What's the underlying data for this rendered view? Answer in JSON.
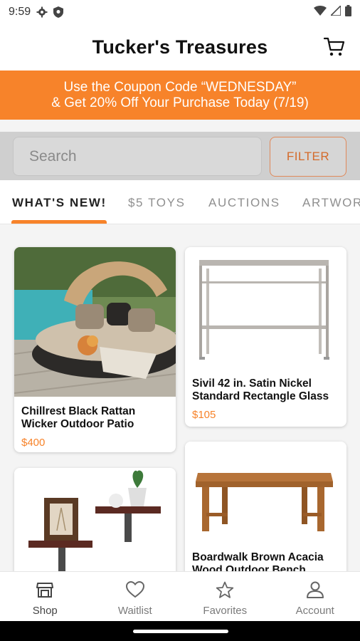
{
  "status_bar": {
    "time": "9:59"
  },
  "app": {
    "title": "Tucker's Treasures"
  },
  "promo": {
    "line1": "Use the Coupon Code “WEDNESDAY”",
    "line2": "& Get 20% Off Your Purchase Today (7/19)"
  },
  "search": {
    "placeholder": "Search",
    "filter_label": "FILTER"
  },
  "tabs": [
    {
      "label": "WHAT'S NEW!"
    },
    {
      "label": "$5 TOYS"
    },
    {
      "label": "AUCTIONS"
    },
    {
      "label": "ARTWOR"
    }
  ],
  "products": [
    {
      "name_line1": "Chillrest Black Rattan",
      "name_line2": "Wicker Outdoor Patio",
      "price": "$400"
    },
    {
      "name_line1": "Sivil 42 in. Satin Nickel",
      "name_line2": "Standard Rectangle Glass",
      "price": "$105"
    },
    {
      "name_line1": "",
      "name_line2": "",
      "price": ""
    },
    {
      "name_line1": "Boardwalk Brown Acacia",
      "name_line2": "Wood Outdoor Bench",
      "price": ""
    }
  ],
  "bottom_nav": [
    {
      "label": "Shop",
      "icon": "shop-icon"
    },
    {
      "label": "Waitlist",
      "icon": "heart-icon"
    },
    {
      "label": "Favorites",
      "icon": "star-icon"
    },
    {
      "label": "Account",
      "icon": "person-icon"
    }
  ],
  "colors": {
    "accent": "#f7832a",
    "price": "#f7832a",
    "filter_text": "#d46a2a"
  }
}
